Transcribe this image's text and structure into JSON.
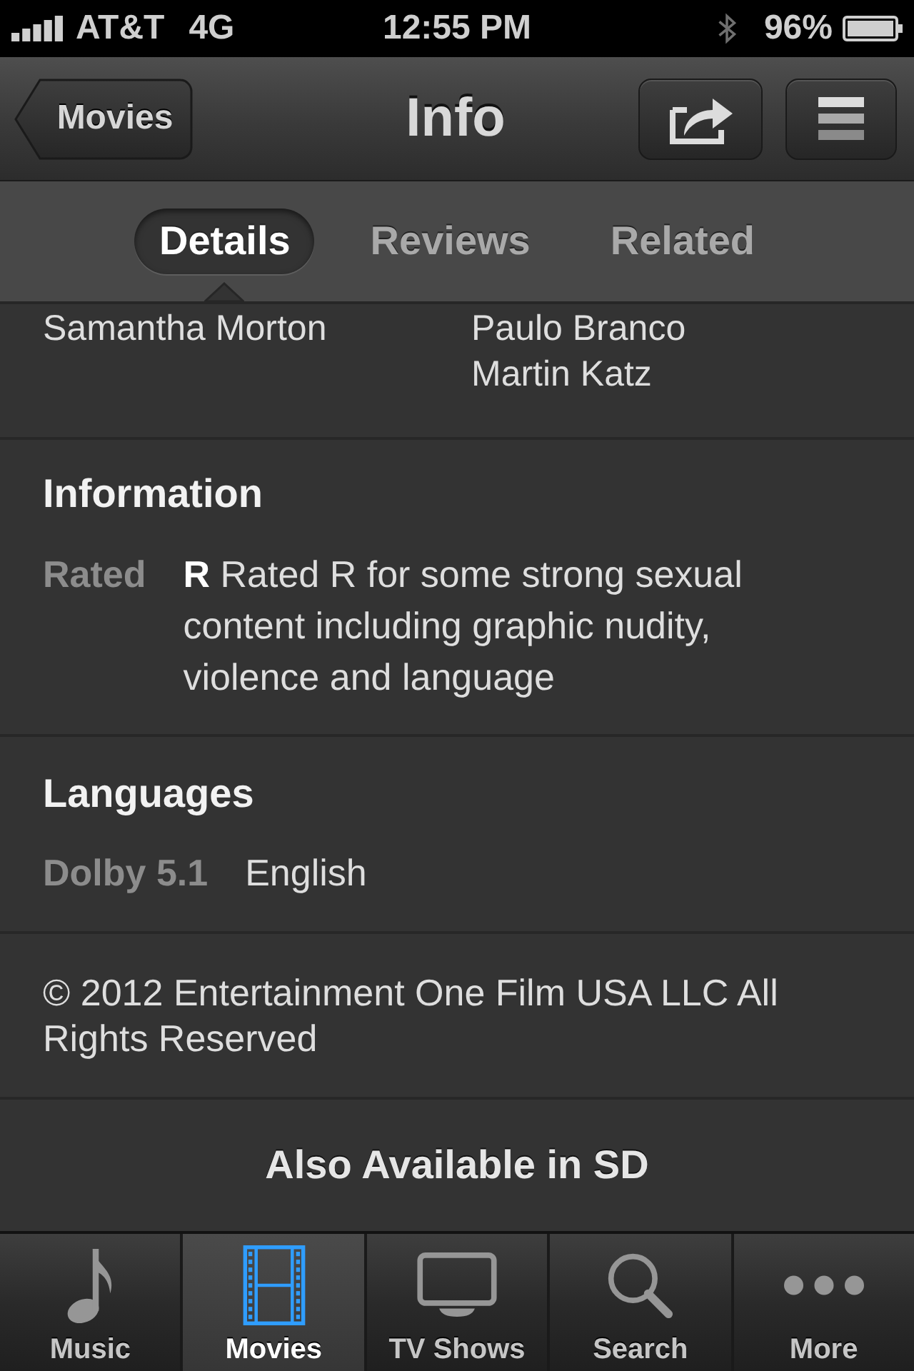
{
  "status_bar": {
    "carrier": "AT&T",
    "network": "4G",
    "time": "12:55 PM",
    "battery": "96%"
  },
  "nav_bar": {
    "back_button": "Movies",
    "title": "Info"
  },
  "segments": [
    {
      "label": "Details",
      "selected": true
    },
    {
      "label": "Reviews",
      "selected": false
    },
    {
      "label": "Related",
      "selected": false
    }
  ],
  "credits": {
    "column_1": [
      "Samantha Morton"
    ],
    "column_2": [
      "Paulo Branco",
      "Martin Katz"
    ]
  },
  "sections": [
    {
      "heading": "Information",
      "rows": [
        {
          "label": "Rated",
          "value": "**R** Rated R for some strong sexual content including graphic nudity, violence and language"
        }
      ]
    },
    {
      "heading": "Languages",
      "rows": [
        {
          "label": "Dolby 5.1",
          "value": "English"
        }
      ]
    }
  ],
  "copyright": "© 2012 Entertainment One Film USA LLC All Rights Reserved",
  "also_available": "Also Available in SD",
  "tab_bar": [
    {
      "label": "Music",
      "selected": false
    },
    {
      "label": "Movies",
      "selected": true
    },
    {
      "label": "TV Shows",
      "selected": false
    },
    {
      "label": "Search",
      "selected": false
    },
    {
      "label": "More",
      "selected": false
    }
  ]
}
